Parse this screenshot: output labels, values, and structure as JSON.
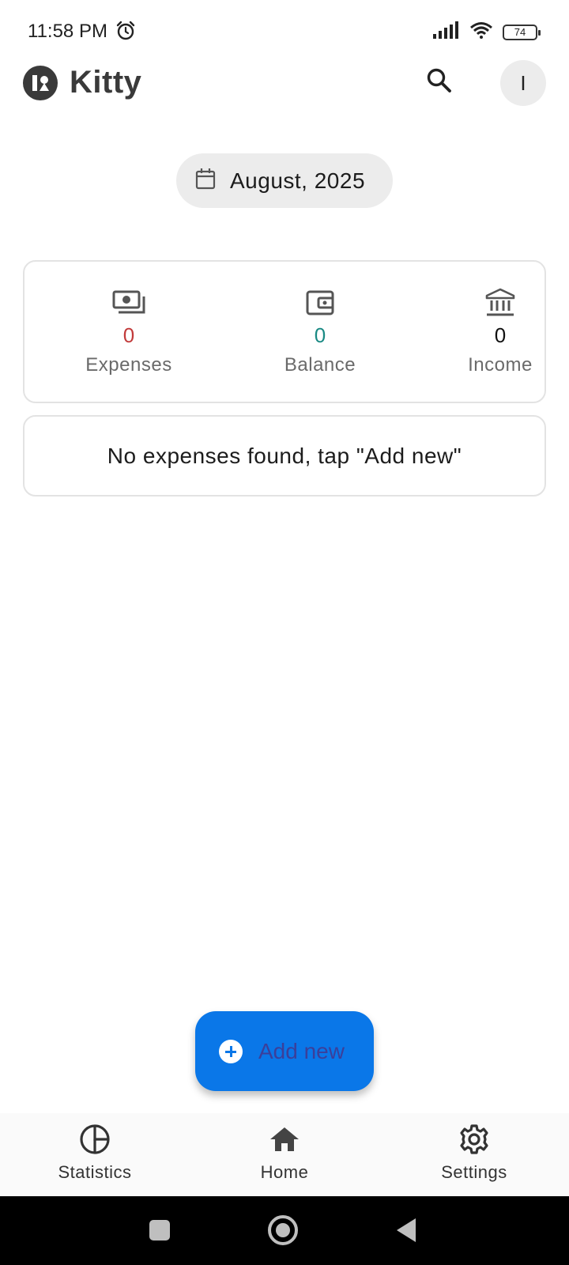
{
  "status_bar": {
    "time": "11:58 PM",
    "battery": "74",
    "icons": [
      "alarm-icon",
      "signal-icon",
      "wifi-icon",
      "battery-icon"
    ]
  },
  "app_bar": {
    "title": "Kitty",
    "avatar_initial": "I",
    "icons": [
      "kitty-logo-icon",
      "search-icon"
    ]
  },
  "month_selector": {
    "label": "August, 2025",
    "icon": "calendar-icon"
  },
  "summary": {
    "expenses": {
      "value": "0",
      "label": "Expenses",
      "icon": "money-icon",
      "color": "#c23b3b"
    },
    "balance": {
      "value": "0",
      "label": "Balance",
      "icon": "wallet-icon",
      "color": "#1a8a84"
    },
    "income": {
      "value": "0",
      "label": "Income",
      "icon": "bank-icon",
      "color": "#111111"
    }
  },
  "empty_state": {
    "message": "No expenses found, tap \"Add new\""
  },
  "fab": {
    "label": "Add new",
    "icon": "add-circle-icon",
    "color": "#0a77e8"
  },
  "bottom_nav": {
    "items": [
      {
        "label": "Statistics",
        "icon": "pie-chart-icon"
      },
      {
        "label": "Home",
        "icon": "home-icon"
      },
      {
        "label": "Settings",
        "icon": "gear-icon"
      }
    ]
  },
  "system_nav": {
    "icons": [
      "recent-apps-icon",
      "home-circle-icon",
      "back-icon"
    ]
  }
}
